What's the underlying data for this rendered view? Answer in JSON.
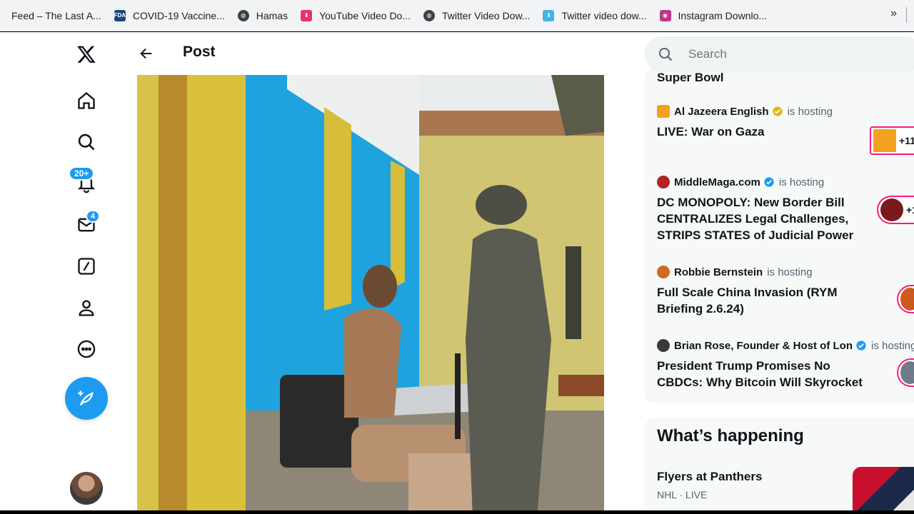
{
  "bookmarks": [
    {
      "label": "Feed – The Last A...",
      "icon": "page-icon",
      "color": "#ffffff"
    },
    {
      "label": "COVID-19 Vaccine...",
      "icon": "fda-icon",
      "color": "#1a4480"
    },
    {
      "label": "Hamas",
      "icon": "globe-icon",
      "color": "#3c4043"
    },
    {
      "label": "YouTube Video Do...",
      "icon": "download-icon",
      "color": "#e8336d"
    },
    {
      "label": "Twitter Video Dow...",
      "icon": "globe-icon",
      "color": "#3c4043"
    },
    {
      "label": "Twitter video dow...",
      "icon": "twitter-download-icon",
      "color": "#3fb5e8"
    },
    {
      "label": "Instagram Downlo...",
      "icon": "instagram-icon",
      "color": "#c13584"
    }
  ],
  "bookmarks_more": "»",
  "nav": {
    "logo": "X",
    "notifications_badge": "20+",
    "messages_badge": "4"
  },
  "main": {
    "title": "Post"
  },
  "search": {
    "placeholder": "Search"
  },
  "spaces": {
    "partial_title": "Super Bowl",
    "items": [
      {
        "host": "Al Jazeera English",
        "verified": "gold",
        "hosting": "is hosting",
        "title": "LIVE: War on Gaza",
        "listeners": "+11",
        "host_color": "#f4a020"
      },
      {
        "host": "MiddleMaga.com",
        "verified": "blue",
        "hosting": "is hosting",
        "title": "DC MONOPOLY: New Border Bill CENTRALIZES Legal Challenges, STRIPS STATES of Judicial Power",
        "listeners": "+1",
        "host_color": "#b22222"
      },
      {
        "host": "Robbie Bernstein",
        "verified": "none",
        "hosting": "is hosting",
        "title": "Full Scale China Invasion (RYM Briefing 2.6.24)",
        "listeners": "",
        "host_color": "#d2691e"
      },
      {
        "host": "Brian Rose, Founder & Host of Lon",
        "verified": "blue",
        "hosting": "is hosting",
        "title": "President Trump Promises No CBDCs: Why Bitcoin Will Skyrocket",
        "listeners": "",
        "host_color": "#3a3a3a"
      }
    ]
  },
  "happening": {
    "title": "What’s happening",
    "trend": {
      "name": "Flyers at Panthers",
      "meta": "NHL · LIVE"
    }
  },
  "colors": {
    "accent": "#1d9bf0",
    "space_ring": "#f91880",
    "muted": "#536471"
  }
}
